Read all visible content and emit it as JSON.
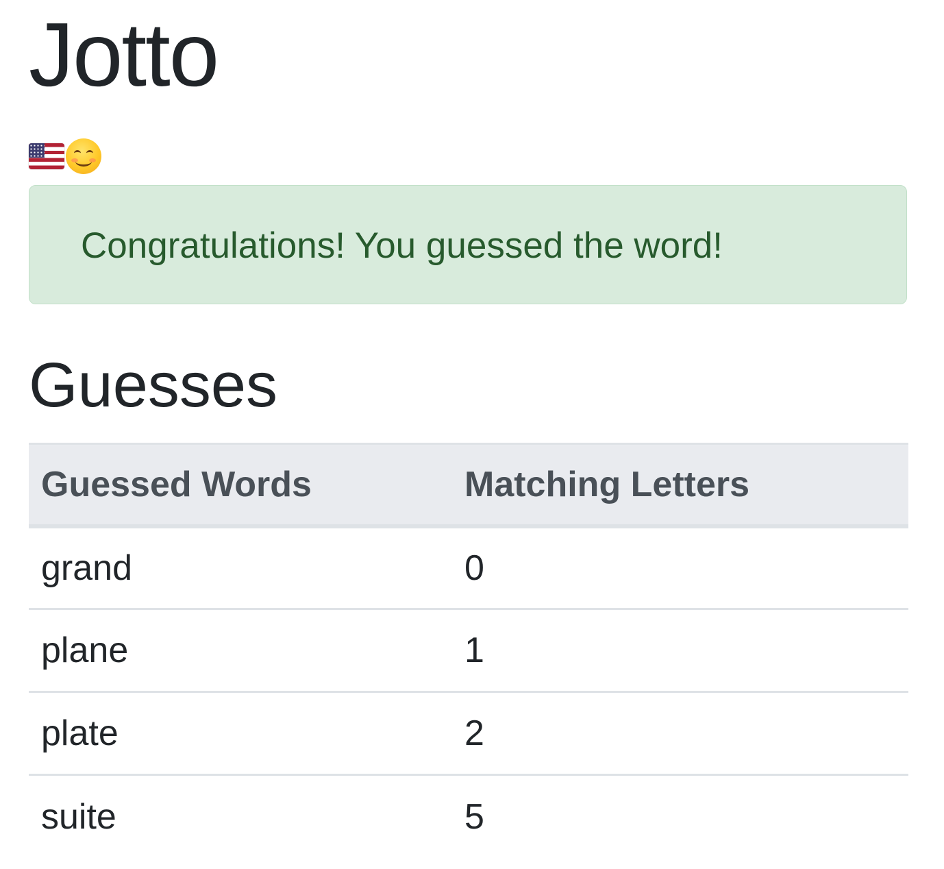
{
  "app": {
    "title": "Jotto"
  },
  "language_selector": {
    "flag_icon": "us-flag-icon",
    "emoji_icon": "smiling-face-icon"
  },
  "alert": {
    "message": "Congratulations! You guessed the word!",
    "color": "#275a2d",
    "background": "#d8ebdc"
  },
  "guesses_section": {
    "title": "Guesses",
    "columns": [
      "Guessed Words",
      "Matching Letters"
    ],
    "rows": [
      {
        "word": "grand",
        "matching": "0"
      },
      {
        "word": "plane",
        "matching": "1"
      },
      {
        "word": "plate",
        "matching": "2"
      },
      {
        "word": "suite",
        "matching": "5"
      }
    ]
  }
}
